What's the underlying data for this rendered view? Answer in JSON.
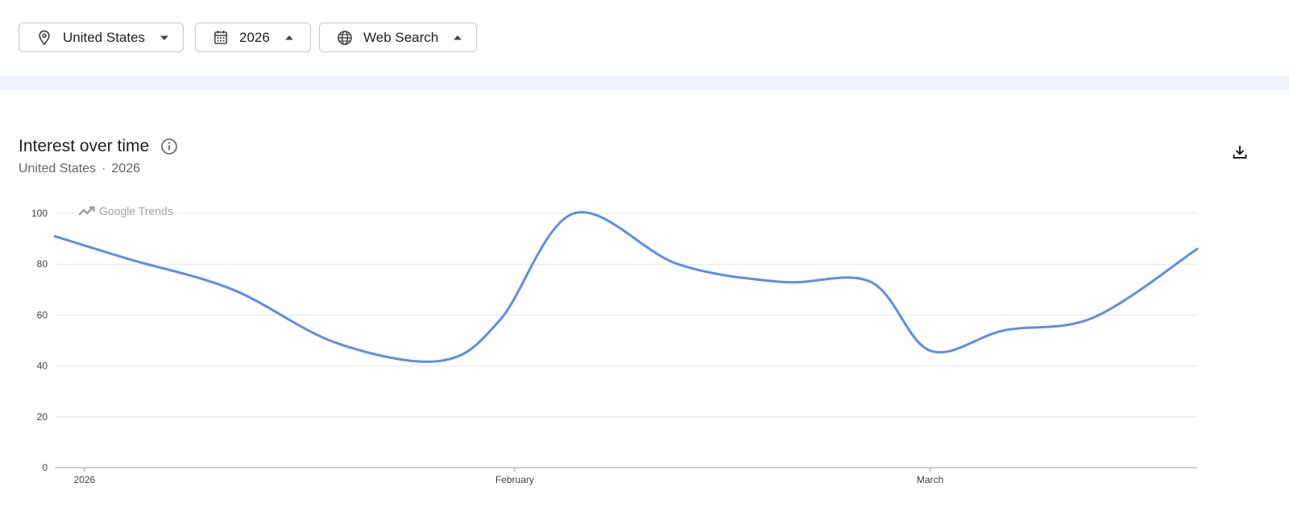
{
  "filters": {
    "location": "United States",
    "year": "2026",
    "search_type": "Web Search"
  },
  "card": {
    "title": "Interest over time",
    "subtitle_location": "United States",
    "subtitle_separator": "·",
    "subtitle_year": "2026",
    "watermark": "Google Trends"
  },
  "icons": {
    "location": "location-pin-icon",
    "year": "calendar-icon",
    "search": "globe-icon",
    "info": "info-icon",
    "download": "download-icon"
  },
  "colors": {
    "line": "#5b8ee6",
    "grid": "#e6e6e6",
    "axis": "#9aa0a6",
    "band": "#eff4fb"
  },
  "chart_data": {
    "type": "line",
    "x": [
      "2026-01-01",
      "2026-01-06",
      "2026-01-13",
      "2026-01-20",
      "2026-01-27",
      "2026-01-31",
      "2026-02-05",
      "2026-02-12",
      "2026-02-19",
      "2026-02-25",
      "2026-03-01",
      "2026-03-06",
      "2026-03-12",
      "2026-03-19"
    ],
    "values": [
      91,
      82,
      70,
      49,
      42,
      58,
      100,
      80,
      73,
      73,
      46,
      54,
      59,
      86
    ],
    "x_range": [
      "2026-01-01",
      "2026-03-19"
    ],
    "x_ticks": [
      {
        "date": "2026-01-03",
        "label": "2026"
      },
      {
        "date": "2026-02-01",
        "label": "February"
      },
      {
        "date": "2026-03-01",
        "label": "March"
      }
    ],
    "y_ticks": [
      0,
      20,
      40,
      60,
      80,
      100
    ],
    "ylim": [
      0,
      100
    ],
    "grid": true
  }
}
